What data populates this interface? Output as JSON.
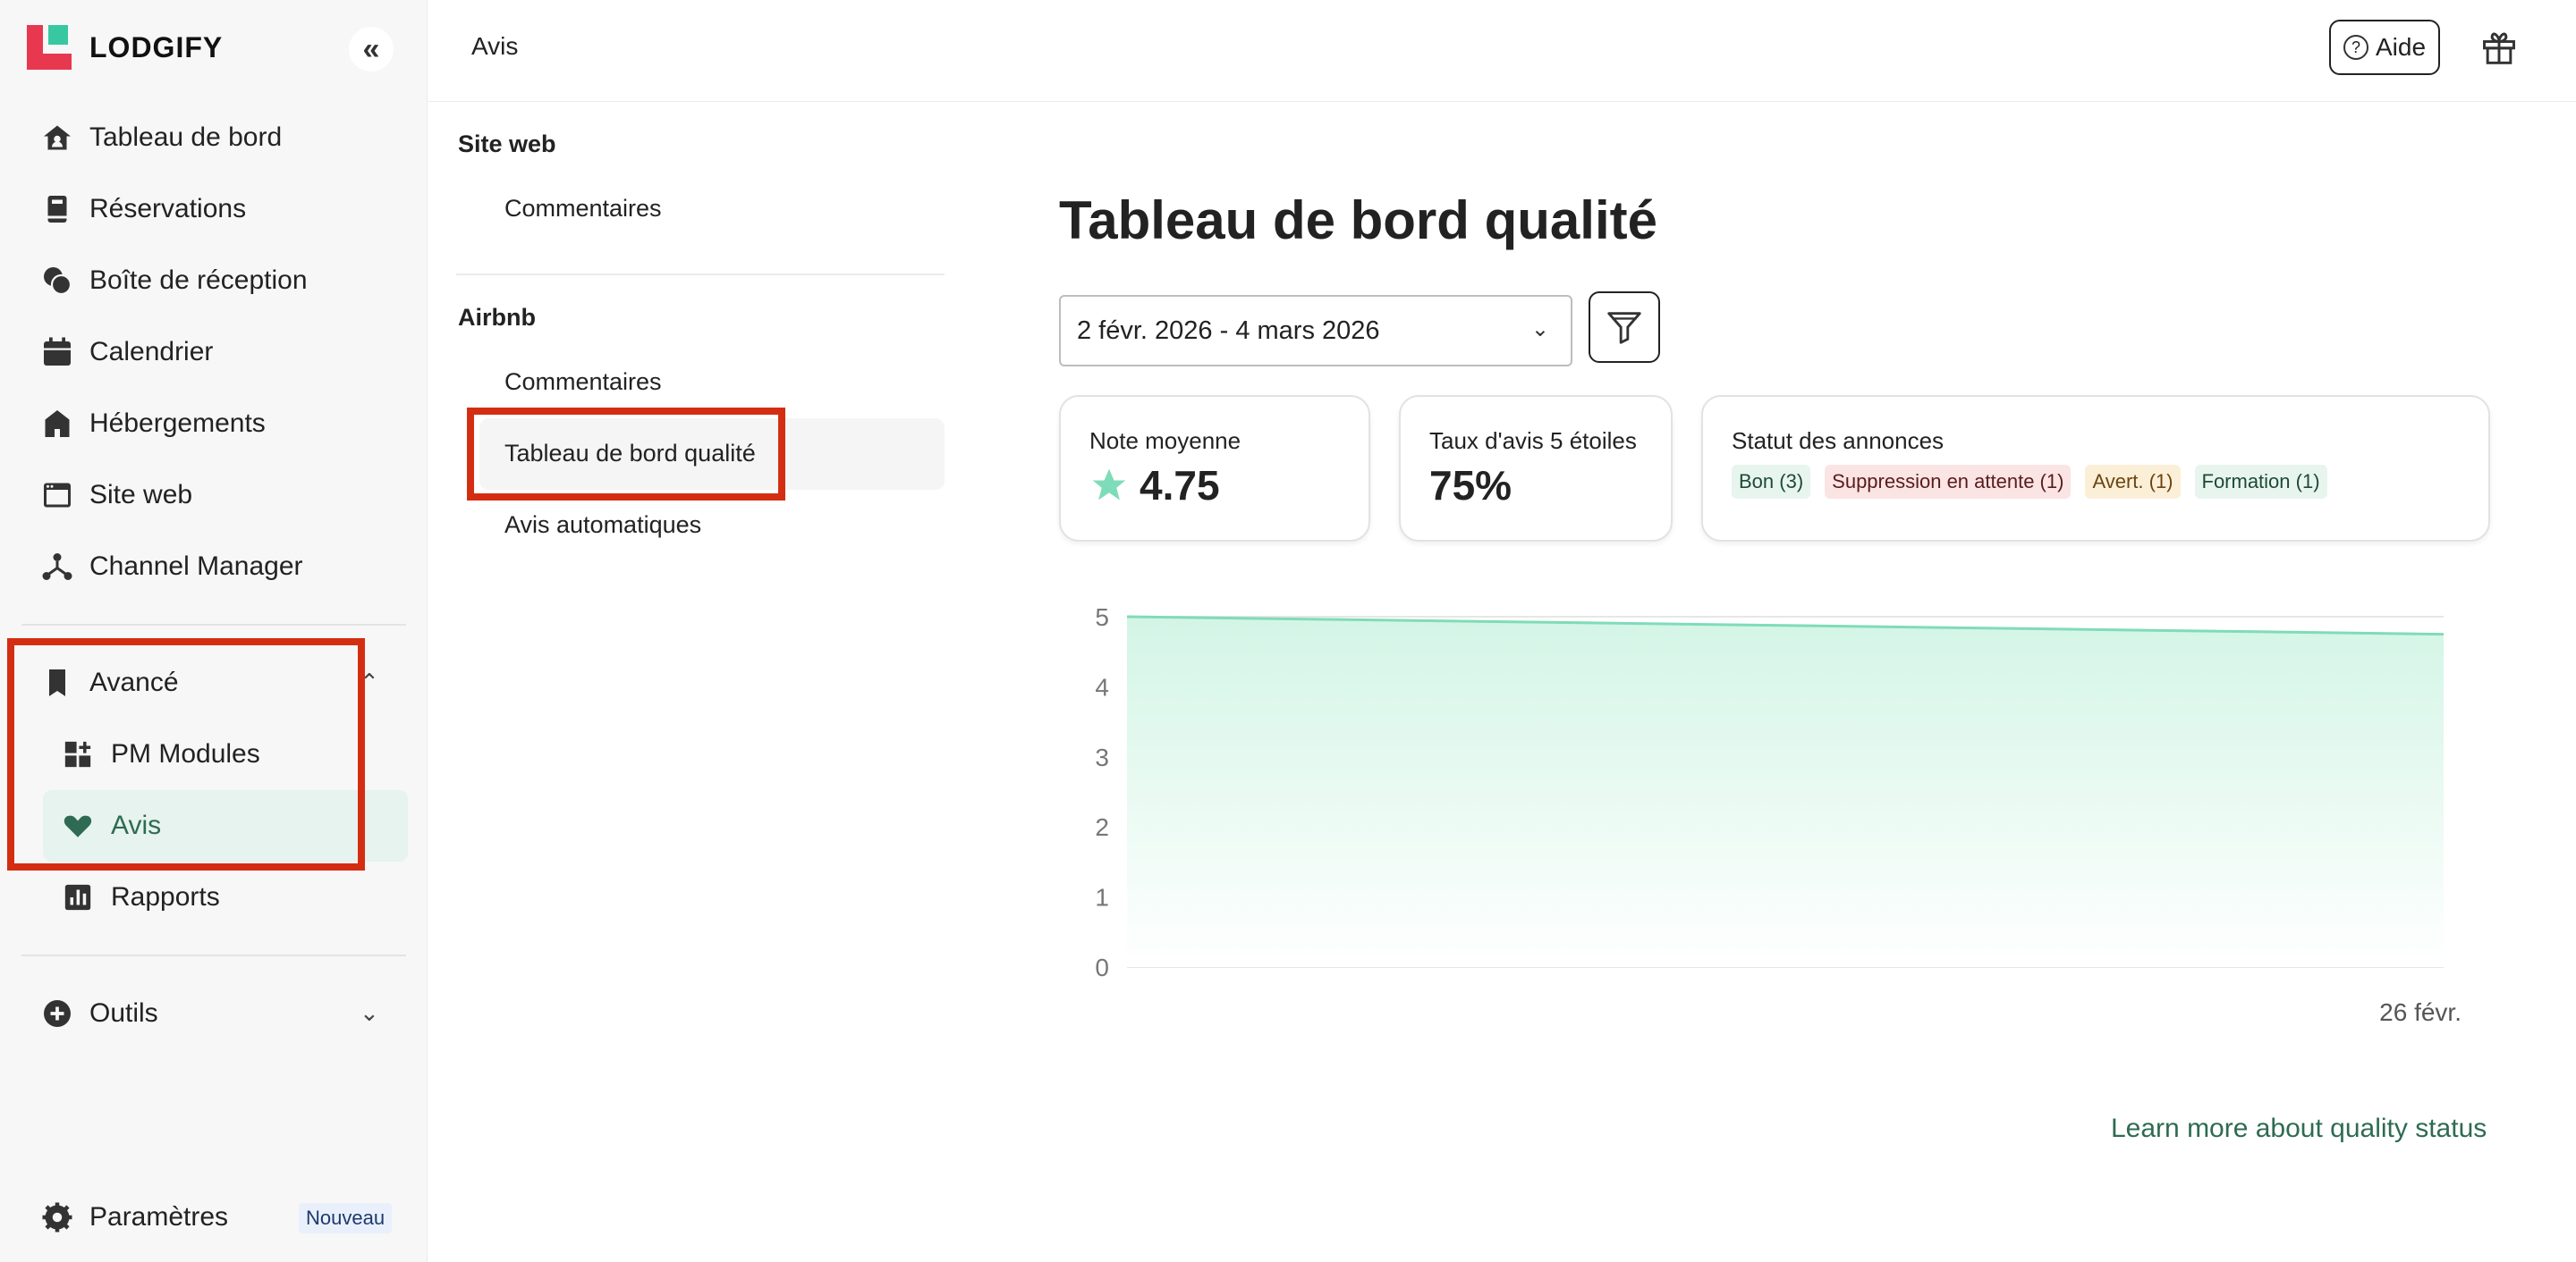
{
  "brand": {
    "name": "LODGIFY"
  },
  "sidebar": {
    "items": [
      {
        "label": "Tableau de bord",
        "icon": "home-icon"
      },
      {
        "label": "Réservations",
        "icon": "book-icon"
      },
      {
        "label": "Boîte de réception",
        "icon": "chat-icon"
      },
      {
        "label": "Calendrier",
        "icon": "calendar-icon"
      },
      {
        "label": "Hébergements",
        "icon": "house-icon"
      },
      {
        "label": "Site web",
        "icon": "browser-icon"
      },
      {
        "label": "Channel Manager",
        "icon": "network-icon"
      }
    ],
    "advanced": {
      "label": "Avancé",
      "children": [
        {
          "label": "PM Modules",
          "icon": "modules-icon"
        },
        {
          "label": "Avis",
          "icon": "heart-icon"
        },
        {
          "label": "Rapports",
          "icon": "chart-icon"
        }
      ]
    },
    "tools_label": "Outils",
    "settings_label": "Paramètres",
    "new_badge": "Nouveau"
  },
  "topbar": {
    "breadcrumb": "Avis",
    "help_label": "Aide"
  },
  "subnav": {
    "sections": [
      {
        "heading": "Site web",
        "items": [
          "Commentaires"
        ]
      },
      {
        "heading": "Airbnb",
        "items": [
          "Commentaires",
          "Tableau de bord qualité",
          "Avis automatiques"
        ]
      }
    ]
  },
  "main": {
    "title": "Tableau de bord qualité",
    "date_range": "2 févr. 2026 - 4 mars 2026",
    "cards": {
      "avg_label": "Note moyenne",
      "avg_value": "4.75",
      "five_star_label": "Taux d'avis 5 étoiles",
      "five_star_value": "75%",
      "status_label": "Statut des annonces",
      "status_chips": [
        {
          "label": "Bon (3)",
          "bg": "#e8f5ee",
          "fg": "#1d4a35"
        },
        {
          "label": "Suppression en attente (1)",
          "bg": "#fbe4e4",
          "fg": "#5a1c1c"
        },
        {
          "label": "Avert. (1)",
          "bg": "#fcefd8",
          "fg": "#6b4410"
        },
        {
          "label": "Formation (1)",
          "bg": "#e8f5ee",
          "fg": "#1d4a35"
        }
      ]
    },
    "learn_more": "Learn more about quality status"
  },
  "colors": {
    "accent": "#2e6b52",
    "highlight": "#d42e12",
    "chart_line": "#7fdcb8",
    "chart_fill": "#d9f6ea"
  },
  "chart_data": {
    "type": "area",
    "x": [
      "",
      "26 févr."
    ],
    "values": [
      5.0,
      4.75
    ],
    "y_ticks": [
      "0",
      "1",
      "2",
      "3",
      "4",
      "5"
    ],
    "ylim": [
      0,
      5
    ],
    "grid": true,
    "legend": "none"
  }
}
